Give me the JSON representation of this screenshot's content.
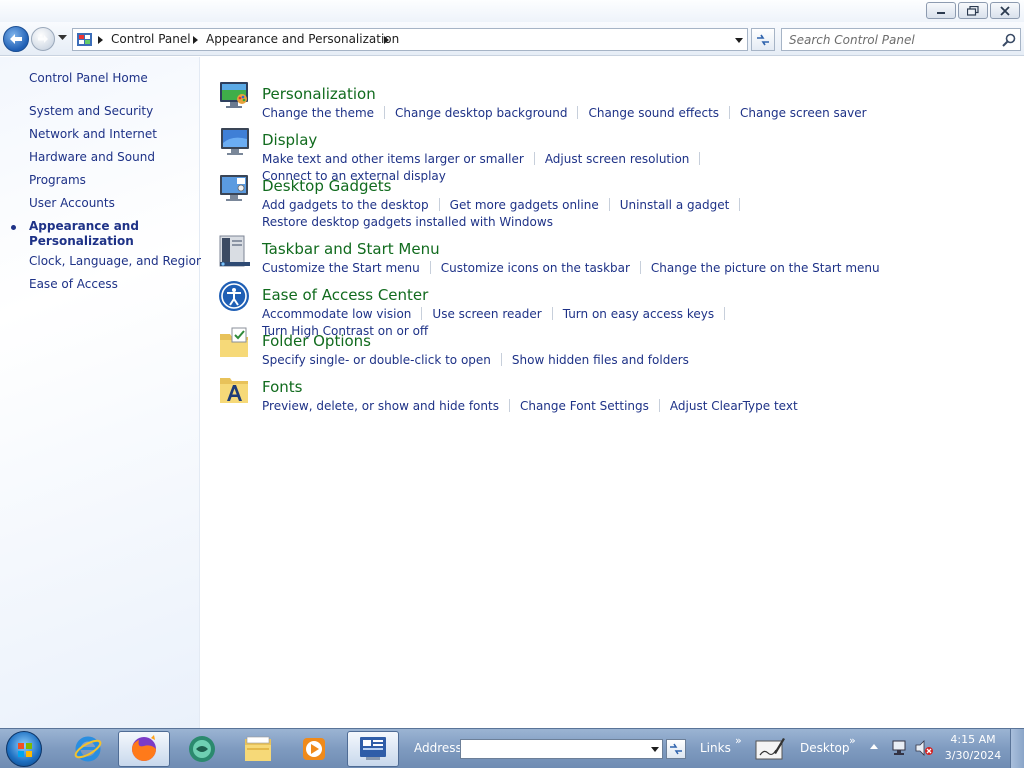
{
  "navbar": {
    "breadcrumb": [
      "Control Panel",
      "Appearance and Personalization"
    ],
    "search_placeholder": "Search Control Panel"
  },
  "left_pane": {
    "home": "Control Panel Home",
    "items": [
      "System and Security",
      "Network and Internet",
      "Hardware and Sound",
      "Programs",
      "User Accounts"
    ],
    "current": "Appearance and Personalization",
    "items_after": [
      "Clock, Language, and Region",
      "Ease of Access"
    ]
  },
  "categories": [
    {
      "title": "Personalization",
      "icon": "personalization-icon",
      "links": [
        "Change the theme",
        "Change desktop background",
        "Change sound effects",
        "Change screen saver"
      ]
    },
    {
      "title": "Display",
      "icon": "display-icon",
      "links": [
        "Make text and other items larger or smaller",
        "Adjust screen resolution",
        "Connect to an external display"
      ]
    },
    {
      "title": "Desktop Gadgets",
      "icon": "desktop-gadgets-icon",
      "links": [
        "Add gadgets to the desktop",
        "Get more gadgets online",
        "Uninstall a gadget"
      ],
      "links_line2": [
        "Restore desktop gadgets installed with Windows"
      ]
    },
    {
      "title": "Taskbar and Start Menu",
      "icon": "taskbar-icon",
      "links": [
        "Customize the Start menu",
        "Customize icons on the taskbar",
        "Change the picture on the Start menu"
      ]
    },
    {
      "title": "Ease of Access Center",
      "icon": "ease-of-access-icon",
      "links": [
        "Accommodate low vision",
        "Use screen reader",
        "Turn on easy access keys",
        "Turn High Contrast on or off"
      ]
    },
    {
      "title": "Folder Options",
      "icon": "folder-options-icon",
      "links": [
        "Specify single- or double-click to open",
        "Show hidden files and folders"
      ]
    },
    {
      "title": "Fonts",
      "icon": "fonts-icon",
      "links": [
        "Preview, delete, or show and hide fonts",
        "Change Font Settings",
        "Adjust ClearType text"
      ]
    }
  ],
  "taskbar": {
    "address_label": "Address",
    "address_value": "",
    "links_label": "Links",
    "desktop_label": "Desktop",
    "time": "4:15 AM",
    "date": "3/30/2024"
  },
  "colors": {
    "link": "#1e3287",
    "category_title": "#116b1e",
    "taskbar": "#7f9bc0"
  }
}
